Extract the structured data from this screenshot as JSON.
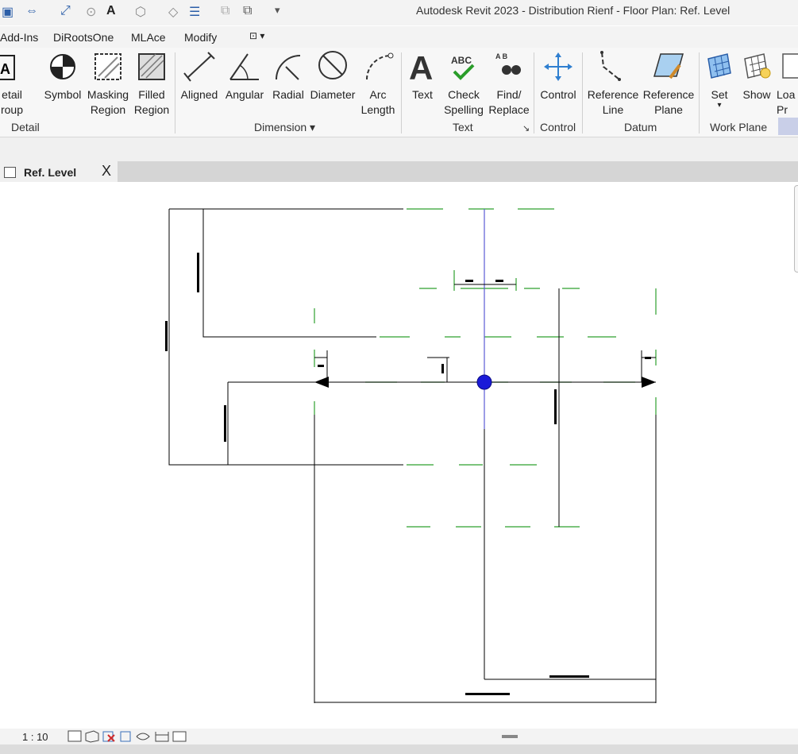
{
  "app": {
    "title": "Autodesk Revit 2023 - Distribution Rienf - Floor Plan: Ref. Level"
  },
  "tabs": [
    "Add-Ins",
    "DiRootsOne",
    "MLAce",
    "Modify"
  ],
  "ribbon": {
    "detail_panel": {
      "label": "Detail",
      "tools": {
        "detail_group": "etail\nroup",
        "symbol": "Symbol",
        "masking_region": "Masking\nRegion",
        "filled_region": "Filled\nRegion"
      }
    },
    "dimension_panel": {
      "label": "Dimension",
      "tools": {
        "aligned": "Aligned",
        "angular": "Angular",
        "radial": "Radial",
        "diameter": "Diameter",
        "arc_length": "Arc\nLength"
      }
    },
    "text_panel": {
      "label": "Text",
      "tools": {
        "text": "Text",
        "check_spelling": "Check\nSpelling",
        "find_replace": "Find/\nReplace"
      }
    },
    "control_panel": {
      "label": "Control",
      "tools": {
        "control": "Control"
      }
    },
    "datum_panel": {
      "label": "Datum",
      "tools": {
        "reference_line": "Reference\nLine",
        "reference_plane": "Reference\nPlane"
      }
    },
    "work_plane_panel": {
      "label": "Work Plane",
      "tools": {
        "set": "Set",
        "show": "Show",
        "load": "Loa\nPr"
      }
    }
  },
  "document_tab": {
    "label": "Ref. Level",
    "close": "X"
  },
  "status": {
    "scale": "1 : 10"
  },
  "colors": {
    "dimension_line": "#000000",
    "reference_plane": "#2ea02e",
    "origin_marker": "#1a1ad8",
    "center_plane": "#5b5bd6"
  }
}
